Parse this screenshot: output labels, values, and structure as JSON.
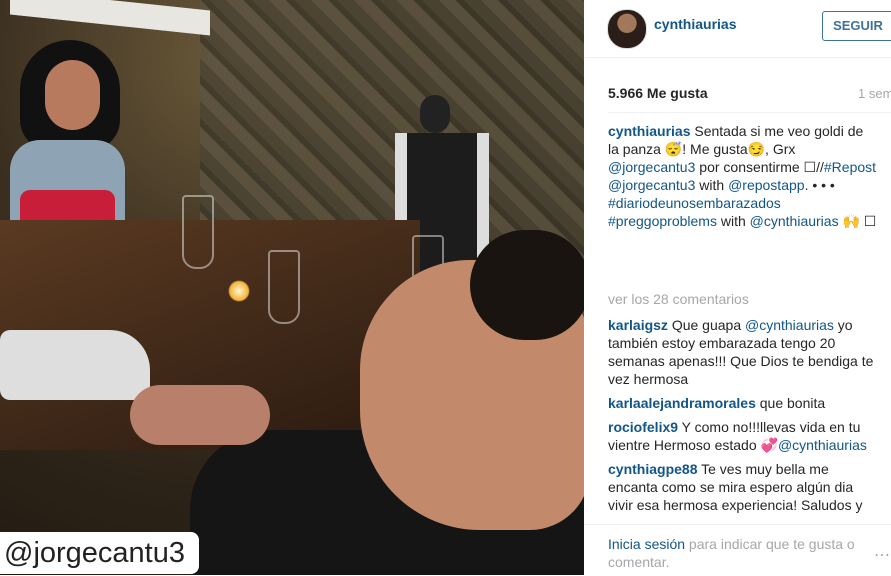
{
  "photo": {
    "watermark": "@jorgecantu3"
  },
  "post": {
    "username": "cynthiaurias",
    "follow_label": "SEGUIR",
    "likes": "5.966 Me gusta",
    "time": "1 sem",
    "caption": {
      "username": "cynthiaurias",
      "t1": " Sentada si me veo goldi de la panza 😴! Me gusta😏, Grx ",
      "m1": "@jorgecantu3",
      "t2": " por consentirme ☐//",
      "h1": "#Repost",
      "t3": " ",
      "m2": "@jorgecantu3",
      "t4": " with ",
      "m3": "@repostapp",
      "t5": ". • • • ",
      "h2": "#diariodeunosembarazados",
      "t6": " ",
      "h3": "#preggoproblems",
      "t7": " with ",
      "m4": "@cynthiaurias",
      "t8": " 🙌 ☐"
    },
    "view_comments": "ver los 28 comentarios",
    "comments": [
      {
        "user": "karlaigsz",
        "text_a": " Que guapa ",
        "mention": "@cynthiaurias",
        "text_b": " yo también estoy embarazada tengo 20 semanas apenas!!! Que Dios te bendiga te vez hermosa"
      },
      {
        "user": "karlaalejandramorales",
        "text_a": " que bonita",
        "mention": "",
        "text_b": ""
      },
      {
        "user": "rociofelix9",
        "text_a": " Y como no!!!llevas vida en tu vientre Hermoso estado 💞",
        "mention": "@cynthiaurias",
        "text_b": ""
      },
      {
        "user": "cynthiagpe88",
        "text_a": " Te ves muy bella me encanta como se mira espero algún dia vivir esa hermosa experiencia! Saludos y",
        "mention": "",
        "text_b": ""
      }
    ],
    "login_link": "Inicia sesión",
    "login_text": " para indicar que te gusta o comentar.",
    "more_icon": "ellipsis-icon"
  }
}
